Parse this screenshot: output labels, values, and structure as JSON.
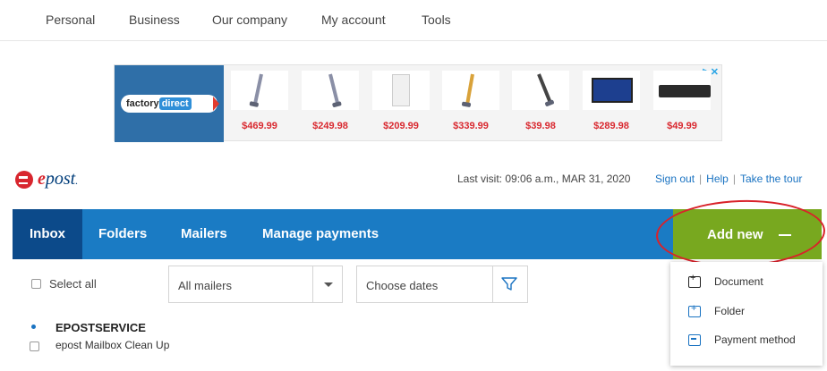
{
  "topnav": {
    "items": [
      "Personal",
      "Business",
      "Our company",
      "My account",
      "Tools"
    ]
  },
  "ad": {
    "brand_left": "factory",
    "brand_right": "direct",
    "adchoice": "▷✕",
    "prices": [
      "$469.99",
      "$249.98",
      "$209.99",
      "$339.99",
      "$39.98",
      "$289.98",
      "$49.99"
    ]
  },
  "brand": {
    "logo_e": "e",
    "logo_rest": "post",
    "logo_dot": "."
  },
  "header": {
    "last_visit": "Last visit: 09:06 a.m., MAR 31, 2020",
    "links": [
      "Sign out",
      "Help",
      "Take the tour"
    ],
    "separator": "|"
  },
  "tabs": [
    {
      "label": "Inbox",
      "active": true
    },
    {
      "label": "Folders",
      "active": false
    },
    {
      "label": "Mailers",
      "active": false
    },
    {
      "label": "Manage payments",
      "active": false
    }
  ],
  "add_new": {
    "label": "Add new",
    "color": "#78a81f"
  },
  "filters": {
    "select_all": "Select all",
    "mailers_value": "All mailers",
    "dates_placeholder": "Choose dates"
  },
  "inbox": {
    "items": [
      {
        "sender": "EPOSTSERVICE",
        "subject": "epost Mailbox Clean Up",
        "unread": true
      }
    ]
  },
  "menu": {
    "items": [
      {
        "label": "Document",
        "icon": "document-add-icon"
      },
      {
        "label": "Folder",
        "icon": "folder-add-icon"
      },
      {
        "label": "Payment method",
        "icon": "payment-card-icon"
      }
    ]
  },
  "colors": {
    "tab_bar": "#1a7bc4",
    "tab_active": "#0c4a8a",
    "link": "#1a73c2",
    "price": "#d9282f",
    "annotation_circle": "#d9222a",
    "highlight": "#f6f13a"
  }
}
